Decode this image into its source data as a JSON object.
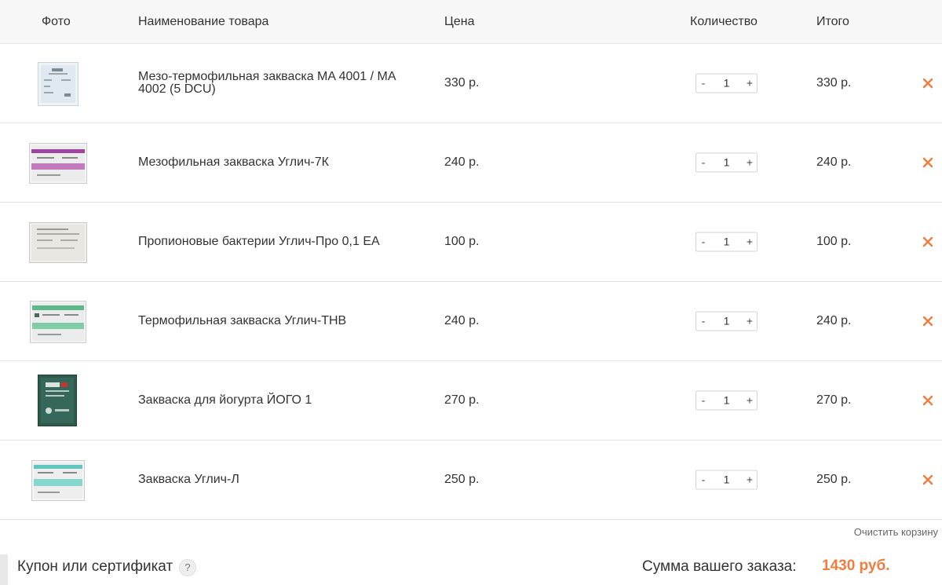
{
  "colors": {
    "accent": "#f07c3e",
    "header_bg": "#f7f7f7",
    "border": "#e2e2e2",
    "text": "#333333"
  },
  "header": {
    "photo": "Фото",
    "name": "Наименование товара",
    "price": "Цена",
    "quantity": "Количество",
    "total": "Итого"
  },
  "qty_controls": {
    "minus": "-",
    "plus": "+"
  },
  "items": [
    {
      "name": "Мезо-термофильная закваска MA 4001 / MA 4002 (5 DCU)",
      "price": "330 р.",
      "quantity": "1",
      "total": "330 р.",
      "photo_icon": "white-sachet-blue-label-icon"
    },
    {
      "name": "Мезофильная закваска Углич-7К",
      "price": "240 р.",
      "quantity": "1",
      "total": "240 р.",
      "photo_icon": "white-sachet-pink-stripe-icon"
    },
    {
      "name": "Пропионовые бактерии Углич-Про 0,1 ЕА",
      "price": "100 р.",
      "quantity": "1",
      "total": "100 р.",
      "photo_icon": "white-sachet-plain-icon"
    },
    {
      "name": "Термофильная закваска Углич-ТНВ",
      "price": "240 р.",
      "quantity": "1",
      "total": "240 р.",
      "photo_icon": "white-sachet-green-stripe-icon"
    },
    {
      "name": "Закваска для йогурта ЙОГО 1",
      "price": "270 р.",
      "quantity": "1",
      "total": "270 р.",
      "photo_icon": "dark-green-sachet-icon"
    },
    {
      "name": "Закваска Углич-Л",
      "price": "250 р.",
      "quantity": "1",
      "total": "250 р.",
      "photo_icon": "white-sachet-teal-stripe-icon"
    }
  ],
  "clear_cart": "Очистить корзину",
  "coupon": {
    "label": "Купон или сертификат",
    "help": "?"
  },
  "summary": {
    "label": "Сумма вашего заказа:",
    "value": "1430 руб."
  }
}
